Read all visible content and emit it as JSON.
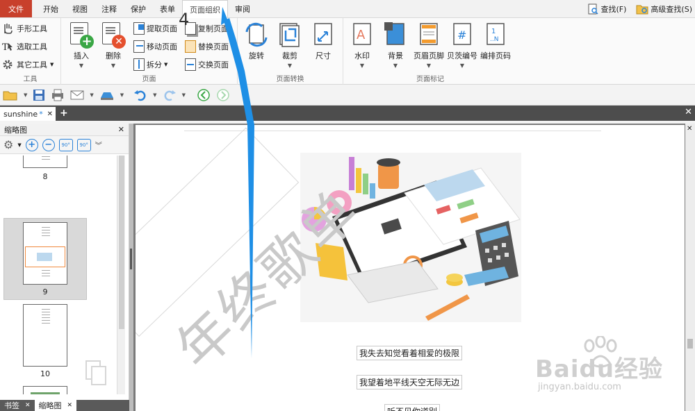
{
  "menu": {
    "file": "文件",
    "items": [
      "开始",
      "视图",
      "注释",
      "保护",
      "表单",
      "页面组织",
      "审阅"
    ],
    "active_index": 5,
    "find": "查找(F)",
    "advanced_find": "高级查找(S)"
  },
  "ribbon": {
    "tools": {
      "hand": "手形工具",
      "select": "选取工具",
      "other": "其它工具",
      "label": "工具"
    },
    "page_group": {
      "insert": "插入",
      "delete": "删除",
      "extract": "提取页面",
      "move": "移动页面",
      "split": "拆分",
      "copy": "复制页面",
      "replace": "替换页面",
      "swap": "交换页面",
      "label": "页面"
    },
    "transform_group": {
      "rotate": "旋转",
      "crop": "裁剪",
      "size": "尺寸",
      "label": "页面转换"
    },
    "mark_group": {
      "watermark": "水印",
      "background": "背景",
      "header_footer": "页眉页脚",
      "bates": "贝茨编号",
      "page_number": "编排页码",
      "label": "页面标记"
    }
  },
  "tabs": {
    "doc_name": "sunshine",
    "modified_mark": "*"
  },
  "thumbnails": {
    "title": "缩略图",
    "rotate_left": "90°",
    "rotate_right": "90°",
    "pages": [
      "8",
      "9",
      "10"
    ],
    "selected_index": 1
  },
  "bottom_tabs": [
    "书签",
    "缩略图"
  ],
  "document": {
    "watermark": "年终歌单",
    "lines": [
      "我失去知觉看着相爱的极限",
      "我望着地平线天空无际无边",
      "听不见你道别"
    ]
  },
  "annotation": {
    "step": "4"
  },
  "brand": {
    "main": "Baidu经验",
    "sub": "jingyan.baidu.com"
  },
  "colors": {
    "file_red": "#c8402c",
    "accent_blue": "#2a82d8",
    "arrow_blue": "#1e8fe6"
  }
}
